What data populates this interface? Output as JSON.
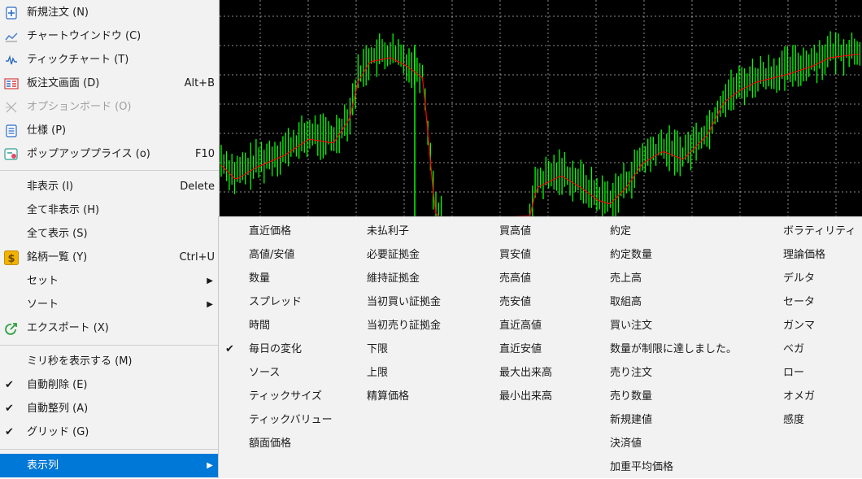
{
  "main_menu": {
    "items": [
      {
        "label": "新規注文 (N)",
        "shortcut": "",
        "icon": "new-order-icon"
      },
      {
        "label": "チャートウインドウ (C)",
        "shortcut": "",
        "icon": "chart-window-icon"
      },
      {
        "label": "ティックチャート (T)",
        "shortcut": "",
        "icon": "tick-chart-icon"
      },
      {
        "label": "板注文画面 (D)",
        "shortcut": "Alt+B",
        "icon": "order-book-icon"
      },
      {
        "label": "オプションボード (O)",
        "shortcut": "",
        "icon": "option-board-icon",
        "disabled": true
      },
      {
        "label": "仕様 (P)",
        "shortcut": "",
        "icon": "specification-icon"
      },
      {
        "label": "ポップアッププライス (o)",
        "shortcut": "F10",
        "icon": "popup-price-icon"
      },
      {
        "label": "非表示 (I)",
        "shortcut": "Delete"
      },
      {
        "label": "全て非表示 (H)",
        "shortcut": ""
      },
      {
        "label": "全て表示 (S)",
        "shortcut": ""
      },
      {
        "label": "銘柄一覧 (Y)",
        "shortcut": "Ctrl+U",
        "icon": "symbol-list-icon"
      },
      {
        "label": "セット",
        "submenu": true
      },
      {
        "label": "ソート",
        "submenu": true
      },
      {
        "label": "エクスポート (X)",
        "shortcut": "",
        "icon": "export-icon"
      },
      {
        "label": "ミリ秒を表示する (M)",
        "shortcut": ""
      },
      {
        "label": "自動削除 (E)",
        "checked": true
      },
      {
        "label": "自動整列 (A)",
        "checked": true
      },
      {
        "label": "グリッド (G)",
        "checked": true
      },
      {
        "label": "表示列",
        "submenu": true,
        "active": true
      }
    ],
    "check_mark": "✔",
    "arrow": "▶"
  },
  "columns_submenu": {
    "col1": [
      "直近価格",
      "高値/安値",
      "数量",
      "スプレッド",
      "時間",
      "毎日の変化",
      "ソース",
      "ティックサイズ",
      "ティックバリュー",
      "額面価格"
    ],
    "col1_checked": "毎日の変化",
    "col2": [
      "未払利子",
      "必要証拠金",
      "維持証拠金",
      "当初買い証拠金",
      "当初売り証拠金",
      "下限",
      "上限",
      "精算価格"
    ],
    "col3": [
      "買高値",
      "買安値",
      "売高値",
      "売安値",
      "直近高値",
      "直近安値",
      "最大出来高",
      "最小出来高"
    ],
    "col4": [
      "約定",
      "約定数量",
      "売上高",
      "取組高",
      "買い注文",
      "数量が制限に達しました。",
      "売り注文",
      "売り数量",
      "新規建値",
      "決済値",
      "加重平均価格"
    ],
    "col5": [
      "ボラティリティ",
      "理論価格",
      "デルタ",
      "セータ",
      "ガンマ",
      "ベガ",
      "ロー",
      "オメガ",
      "感度"
    ]
  },
  "chart": {
    "background": "#000000",
    "grid_color": "#ffffff",
    "candle_color": "#00ff00",
    "ma_color": "#ff0000"
  }
}
